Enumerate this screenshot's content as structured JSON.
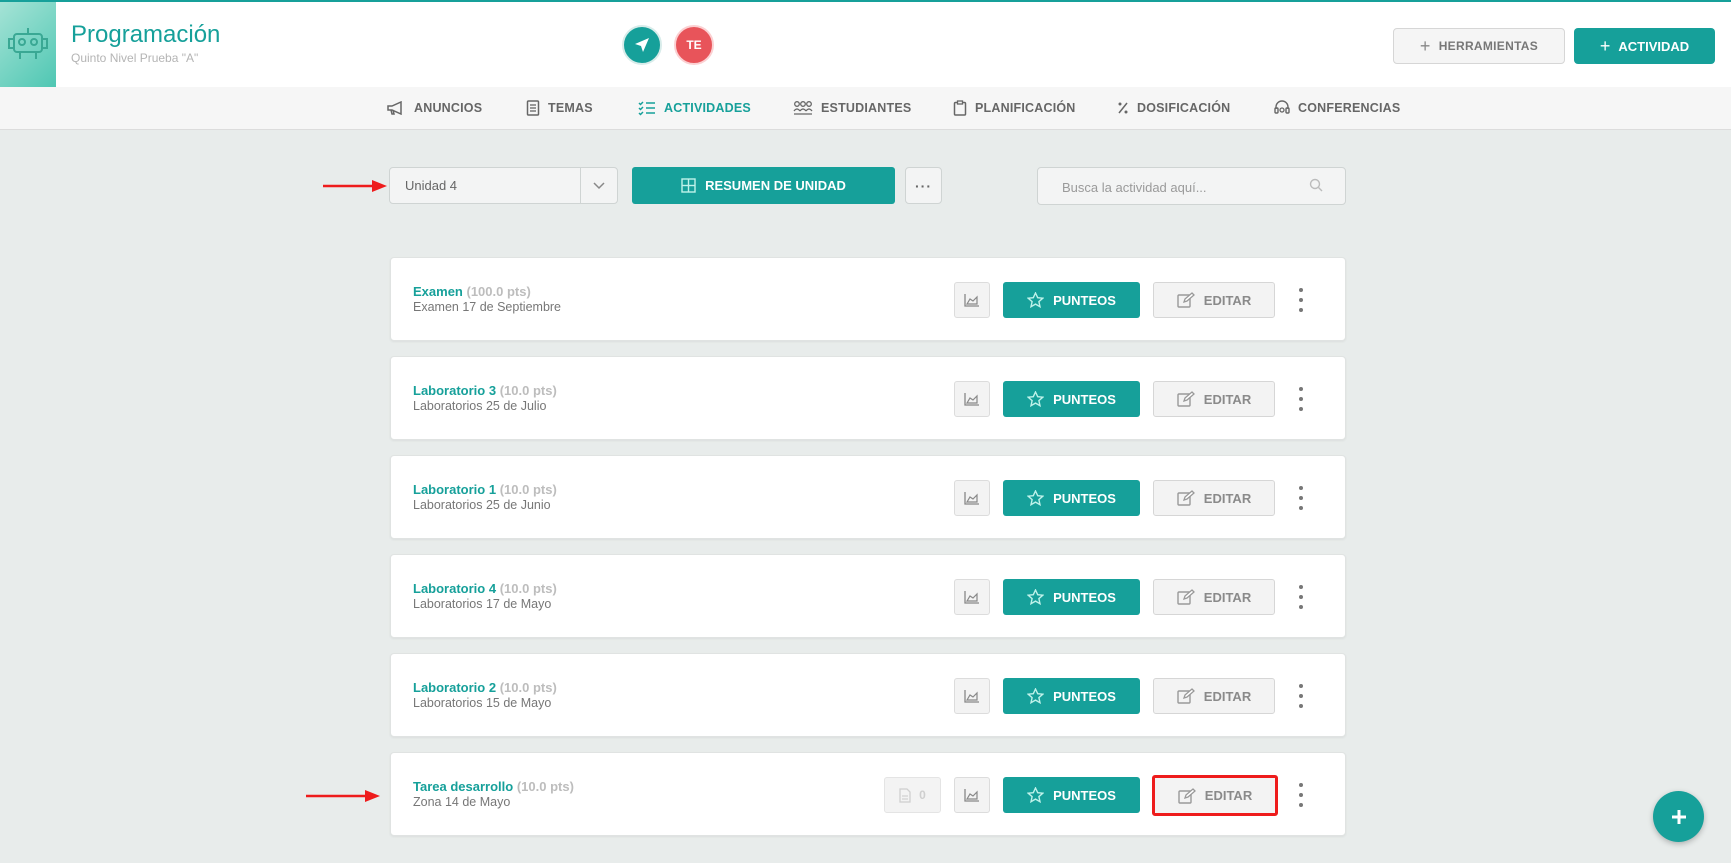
{
  "header": {
    "course_title": "Programación",
    "course_subtitle": "Quinto Nivel Prueba \"A\"",
    "avatar_initials": "TE",
    "tools_label": "HERRAMIENTAS",
    "activity_label": "ACTIVIDAD"
  },
  "nav": {
    "items": [
      {
        "label": "ANUNCIOS",
        "icon": "megaphone-icon"
      },
      {
        "label": "TEMAS",
        "icon": "book-icon"
      },
      {
        "label": "ACTIVIDADES",
        "icon": "checklist-icon",
        "active": true
      },
      {
        "label": "ESTUDIANTES",
        "icon": "students-icon"
      },
      {
        "label": "PLANIFICACIÓN",
        "icon": "clipboard-icon"
      },
      {
        "label": "DOSIFICACIÓN",
        "icon": "percent-icon"
      },
      {
        "label": "CONFERENCIAS",
        "icon": "conference-icon"
      }
    ]
  },
  "toolbar": {
    "unit_selected": "Unidad 4",
    "summary_label": "RESUMEN DE UNIDAD",
    "more_label": "···",
    "search_placeholder": "Busca la actividad aquí..."
  },
  "activities": [
    {
      "title": "Examen",
      "points": "(100.0 pts)",
      "subtitle": "Examen 17 de Septiembre"
    },
    {
      "title": "Laboratorio 3",
      "points": "(10.0 pts)",
      "subtitle": "Laboratorios 25 de Julio"
    },
    {
      "title": "Laboratorio 1",
      "points": "(10.0 pts)",
      "subtitle": "Laboratorios 25 de Junio"
    },
    {
      "title": "Laboratorio 4",
      "points": "(10.0 pts)",
      "subtitle": "Laboratorios 17 de Mayo"
    },
    {
      "title": "Laboratorio 2",
      "points": "(10.0 pts)",
      "subtitle": "Laboratorios 15 de Mayo"
    },
    {
      "title": "Tarea desarrollo",
      "points": "(10.0 pts)",
      "subtitle": "Zona 14 de Mayo",
      "file_count": "0"
    }
  ],
  "buttons": {
    "punteos": "PUNTEOS",
    "editar": "EDITAR"
  },
  "colors": {
    "accent": "#16a09a",
    "annotation": "#ee1c1c",
    "avatar": "#e8545a"
  }
}
